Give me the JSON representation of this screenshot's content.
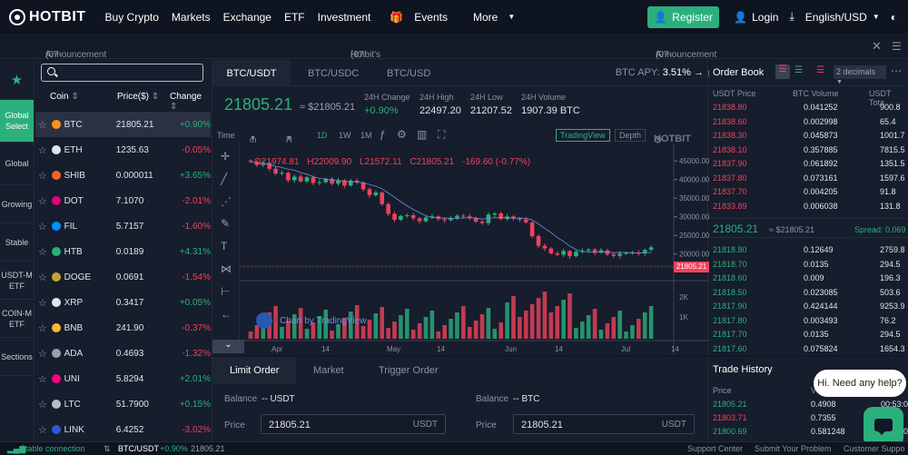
{
  "header": {
    "logo": "HOTBIT",
    "nav": [
      "Buy Crypto",
      "Markets",
      "Exchange",
      "ETF",
      "Investment",
      "Events",
      "More"
    ],
    "register": "Register",
    "login": "Login",
    "lang": "English/USD"
  },
  "announcements": [
    {
      "text": "Announcement on the Suspension of BIRB De...",
      "date": "(07-08)"
    },
    {
      "text": "Hotbit's Announcement Regarding the Suspen...",
      "date": "(07-08)"
    },
    {
      "text": "Announcement on the Reopening of Deposit ...",
      "date": "(07-08)"
    }
  ],
  "leftnav": [
    "Global Select",
    "Global",
    "Growing",
    "Stable",
    "USDT-M ETF",
    "COIN-M ETF",
    "Sections"
  ],
  "coinlist": {
    "headers": {
      "coin": "Coin",
      "price": "Price($)",
      "change": "Change"
    },
    "rows": [
      {
        "coin": "BTC",
        "price": "21805.21",
        "change": "+0.90%",
        "color": "#f7931a"
      },
      {
        "coin": "ETH",
        "price": "1235.63",
        "change": "-0.05%",
        "color": "#e1e4ea"
      },
      {
        "coin": "SHIB",
        "price": "0.000011",
        "change": "+3.65%",
        "color": "#f0622c"
      },
      {
        "coin": "DOT",
        "price": "7.1070",
        "change": "-2.01%",
        "color": "#e6007a"
      },
      {
        "coin": "FIL",
        "price": "5.7157",
        "change": "-1.60%",
        "color": "#0090ff"
      },
      {
        "coin": "HTB",
        "price": "0.0189",
        "change": "+4.31%",
        "color": "#2bb07d"
      },
      {
        "coin": "DOGE",
        "price": "0.0691",
        "change": "-1.54%",
        "color": "#c2a633"
      },
      {
        "coin": "XRP",
        "price": "0.3417",
        "change": "+0.05%",
        "color": "#e1e4ea"
      },
      {
        "coin": "BNB",
        "price": "241.90",
        "change": "-0.37%",
        "color": "#f3ba2f"
      },
      {
        "coin": "ADA",
        "price": "0.4693",
        "change": "-1.32%",
        "color": "#9aa0ad"
      },
      {
        "coin": "UNI",
        "price": "5.8294",
        "change": "+2.01%",
        "color": "#ff007a"
      },
      {
        "coin": "LTC",
        "price": "51.7900",
        "change": "+0.15%",
        "color": "#b8bdc8"
      },
      {
        "coin": "LINK",
        "price": "6.4252",
        "change": "-3.02%",
        "color": "#2a5ada"
      }
    ]
  },
  "chart": {
    "tabs": [
      "BTC/USDT",
      "BTC/USDC",
      "BTC/USD"
    ],
    "apy_label": "BTC APY:",
    "apy_value": "3.51%",
    "price": "21805.21",
    "price_usd": "≈ $21805.21",
    "stats": [
      {
        "label": "24H Change",
        "value": "+0.90%"
      },
      {
        "label": "24H High",
        "value": "22497.20"
      },
      {
        "label": "24H Low",
        "value": "21207.52"
      },
      {
        "label": "24H Volume",
        "value": "1907.39 BTC"
      }
    ],
    "tools": {
      "time": "Time",
      "m": "m",
      "h": "H",
      "d1": "1D",
      "w1": "1W",
      "mo1": "1M",
      "tv": "TradingView",
      "depth": "Depth",
      "brand": "HOTBIT"
    },
    "ohlc": {
      "o": "O21974.81",
      "h": "H22009.90",
      "l": "L21572.11",
      "c": "C21805.21",
      "chg": "-169.60 (-0.77%)"
    },
    "yticks": [
      "45000.00",
      "40000.00",
      "35000.00",
      "30000.00",
      "25000.00",
      "20000.00"
    ],
    "current_price_tag": "21805.21",
    "vol_ticks": [
      "2K",
      "1K"
    ],
    "xticks": [
      "Apr",
      "14",
      "May",
      "14",
      "Jun",
      "14",
      "Jul",
      "14"
    ],
    "tv_credit": "Chart by TradingView"
  },
  "chart_data": {
    "type": "candlestick",
    "title": "",
    "ylim": [
      17000,
      47000
    ],
    "closes": [
      44800,
      43900,
      44500,
      42900,
      41600,
      41800,
      39800,
      40800,
      39500,
      40600,
      39100,
      39300,
      40200,
      38900,
      39800,
      38400,
      39700,
      39200,
      37400,
      35800,
      36500,
      33400,
      30800,
      29200,
      30200,
      30400,
      29600,
      28800,
      29800,
      30100,
      29400,
      29100,
      29600,
      30300,
      30100,
      29700,
      28700,
      28300,
      30600,
      30900,
      29400,
      30100,
      29500,
      29300,
      28500,
      24800,
      22200,
      21500,
      20200,
      19800,
      20800,
      19400,
      20600,
      20900,
      21200,
      20400,
      21000,
      19900,
      19500,
      20100,
      20300,
      20400,
      20200,
      21100,
      21805
    ]
  },
  "form": {
    "tabs": [
      "Limit Order",
      "Market",
      "Trigger Order"
    ],
    "balance_label": "Balance",
    "buy_balance": "-- USDT",
    "sell_balance": "-- BTC",
    "price_label": "Price",
    "buy_price": "21805.21",
    "buy_unit": "USDT",
    "sell_price": "21805.21",
    "sell_unit": "USDT"
  },
  "orderbook": {
    "title": "Order Book",
    "decimals": "2 decimals",
    "cols": [
      "USDT Price",
      "BTC Volume",
      "USDT Tota"
    ],
    "asks": [
      [
        "21838.80",
        "0.041252",
        "900.8"
      ],
      [
        "21838.60",
        "0.002998",
        "65.4"
      ],
      [
        "21838.30",
        "0.045873",
        "1001.7"
      ],
      [
        "21838.10",
        "0.357885",
        "7815.5"
      ],
      [
        "21837.90",
        "0.061892",
        "1351.5"
      ],
      [
        "21837.80",
        "0.073161",
        "1597.6"
      ],
      [
        "21837.70",
        "0.004205",
        "91.8"
      ],
      [
        "21833.89",
        "0.006038",
        "131.8"
      ]
    ],
    "mid": "21805.21",
    "mid_usd": "≈ $21805.21",
    "spread": "Spread: 0.069",
    "bids": [
      [
        "21818.80",
        "0.12649",
        "2759.8"
      ],
      [
        "21818.70",
        "0.0135",
        "294.5"
      ],
      [
        "21818.60",
        "0.009",
        "196.3"
      ],
      [
        "21818.50",
        "0.023085",
        "503.6"
      ],
      [
        "21817.90",
        "0.424144",
        "9253.9"
      ],
      [
        "21817.80",
        "0.003493",
        "76.2"
      ],
      [
        "21817.70",
        "0.0135",
        "294.5"
      ],
      [
        "21817.60",
        "0.075824",
        "1654.3"
      ]
    ]
  },
  "trades": {
    "title": "Trade History",
    "cols": [
      "Price",
      "V"
    ],
    "rows": [
      {
        "price": "21805.21",
        "vol": "0.4908",
        "time": "00:53:0",
        "side": "buy"
      },
      {
        "price": "21803.71",
        "vol": "0.7355",
        "time": "",
        "side": "sell"
      },
      {
        "price": "21800.69",
        "vol": "0.581248",
        "time": "00:53:0",
        "side": "buy"
      }
    ]
  },
  "chat": {
    "bubble": "Hi. Need any help?"
  },
  "footer": {
    "status": "Stable connection",
    "pair": "BTC/USDT",
    "change": "+0.90%",
    "price": "21805.21",
    "links": [
      "Support Center",
      "Submit Your Problem",
      "Customer Suppo"
    ]
  }
}
